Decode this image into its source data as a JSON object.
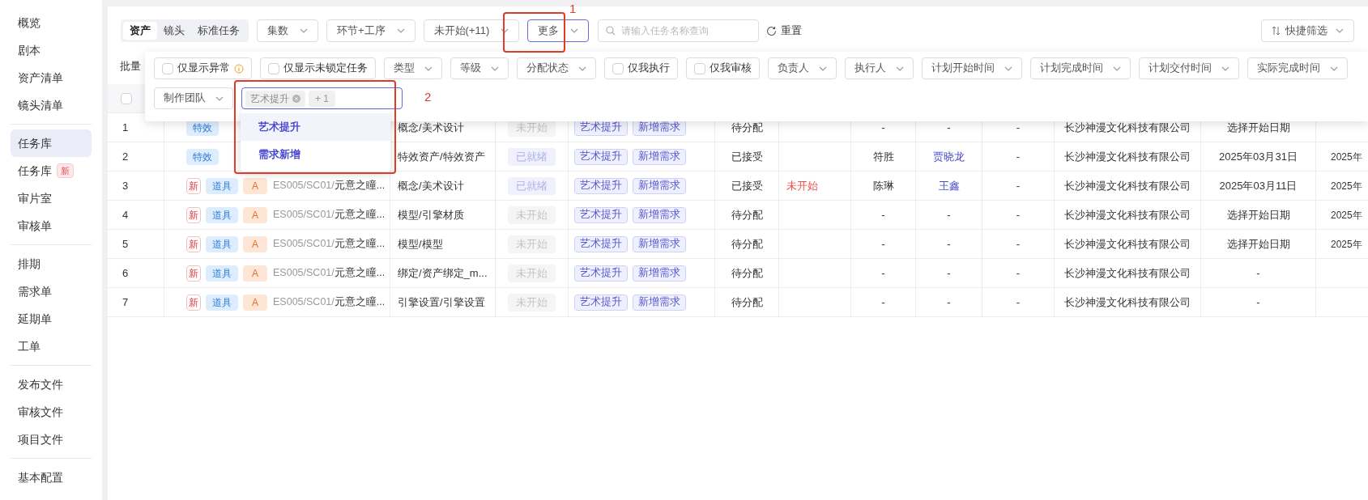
{
  "sidebar": {
    "groups": [
      {
        "items": [
          {
            "label": "概览",
            "selected": false
          },
          {
            "label": "剧本",
            "selected": false
          },
          {
            "label": "资产清单",
            "selected": false
          },
          {
            "label": "镜头清单",
            "selected": false
          }
        ]
      },
      {
        "items": [
          {
            "label": "任务库",
            "selected": true
          },
          {
            "label": "任务库",
            "selected": false,
            "badge": "新"
          },
          {
            "label": "审片室",
            "selected": false
          },
          {
            "label": "审核单",
            "selected": false
          }
        ]
      },
      {
        "items": [
          {
            "label": "排期",
            "selected": false
          },
          {
            "label": "需求单",
            "selected": false
          },
          {
            "label": "延期单",
            "selected": false
          },
          {
            "label": "工单",
            "selected": false
          }
        ]
      },
      {
        "items": [
          {
            "label": "发布文件",
            "selected": false
          },
          {
            "label": "审核文件",
            "selected": false
          },
          {
            "label": "项目文件",
            "selected": false
          }
        ]
      },
      {
        "items": [
          {
            "label": "基本配置",
            "selected": false
          }
        ]
      }
    ]
  },
  "toolbar": {
    "segments": [
      {
        "label": "资产",
        "selected": true
      },
      {
        "label": "镜头",
        "selected": false
      },
      {
        "label": "标准任务",
        "selected": false
      }
    ],
    "filters": [
      {
        "label": "集数",
        "active": false
      },
      {
        "label": "环节+工序",
        "active": false
      },
      {
        "label": "未开始(+11)",
        "active": false
      },
      {
        "label": "更多",
        "active": true
      }
    ],
    "search": {
      "placeholder": "请输入任务名称查询"
    },
    "reset": "重置",
    "quick_filter": "快捷筛选"
  },
  "batch_label": "批量",
  "header_checkbox": {
    "checked": false
  },
  "filter_panel": {
    "rows": [
      [
        {
          "kind": "checkbox",
          "label": "仅显示异常",
          "checked": false,
          "info": true
        },
        {
          "kind": "checkbox",
          "label": "仅显示未锁定任务",
          "checked": false
        },
        {
          "kind": "select",
          "label": "类型"
        },
        {
          "kind": "select",
          "label": "等级"
        },
        {
          "kind": "select",
          "label": "分配状态"
        },
        {
          "kind": "checkbox",
          "label": "仅我执行",
          "checked": false
        },
        {
          "kind": "checkbox",
          "label": "仅我审核",
          "checked": false
        },
        {
          "kind": "select",
          "label": "负责人"
        },
        {
          "kind": "select",
          "label": "执行人"
        },
        {
          "kind": "select",
          "label": "计划开始时间"
        },
        {
          "kind": "select",
          "label": "计划完成时间"
        },
        {
          "kind": "select",
          "label": "计划交付时间"
        },
        {
          "kind": "select",
          "label": "实际完成时间"
        }
      ],
      [
        {
          "kind": "select",
          "label": "制作团队"
        },
        {
          "kind": "multiselect",
          "tags": [
            "艺术提升"
          ],
          "more": "+ 1",
          "focused": true
        }
      ]
    ]
  },
  "option_list": [
    {
      "label": "艺术提升",
      "selected": true
    },
    {
      "label": "需求新增",
      "selected": false
    }
  ],
  "table": {
    "rows": [
      {
        "index": "1",
        "badges": [
          {
            "label": "特效",
            "kind": "type"
          }
        ],
        "step": "概念/美术设计",
        "status": {
          "label": "未开始",
          "kind": "not-started"
        },
        "tags": [
          "艺术提升",
          "新增需求"
        ],
        "assignment": "待分配",
        "owner": "-",
        "executor": {
          "label": "-",
          "link": false
        },
        "column_10": "-",
        "company": "长沙神漫文化科技有限公司",
        "date": "选择开始日期"
      },
      {
        "index": "2",
        "badges": [
          {
            "label": "特效",
            "kind": "type"
          }
        ],
        "step": "特效资产/特效资产",
        "status": {
          "label": "已就绪",
          "kind": "ready"
        },
        "tags": [
          "艺术提升",
          "新增需求"
        ],
        "assignment": "已接受",
        "owner": "符胜",
        "executor": {
          "label": "贾晓龙",
          "link": true
        },
        "column_10": "-",
        "company": "长沙神漫文化科技有限公司",
        "date": "2025年03月31日",
        "column_13": "2025年"
      },
      {
        "index": "3",
        "badges": [
          {
            "label": "新",
            "kind": "new"
          },
          {
            "label": "道具",
            "kind": "type"
          },
          {
            "label": "A",
            "kind": "grade"
          }
        ],
        "path": {
          "prefix": "ES005/SC01/",
          "name": "元意之瞳..."
        },
        "step": "概念/美术设计",
        "status": {
          "label": "已就绪",
          "kind": "ready"
        },
        "tags": [
          "艺术提升",
          "新增需求"
        ],
        "assignment": "已接受",
        "progress": "未开始",
        "owner": "陈琳",
        "executor": {
          "label": "王鑫",
          "link": true
        },
        "column_10": "-",
        "company": "长沙神漫文化科技有限公司",
        "date": "2025年03月11日",
        "column_13": "2025年"
      },
      {
        "index": "4",
        "badges": [
          {
            "label": "新",
            "kind": "new"
          },
          {
            "label": "道具",
            "kind": "type"
          },
          {
            "label": "A",
            "kind": "grade"
          }
        ],
        "path": {
          "prefix": "ES005/SC01/",
          "name": "元意之瞳..."
        },
        "step": "模型/引擎材质",
        "status": {
          "label": "未开始",
          "kind": "not-started"
        },
        "tags": [
          "艺术提升",
          "新增需求"
        ],
        "assignment": "待分配",
        "owner": "-",
        "executor": {
          "label": "-",
          "link": false
        },
        "column_10": "-",
        "company": "长沙神漫文化科技有限公司",
        "date": "选择开始日期",
        "column_13": "2025年"
      },
      {
        "index": "5",
        "badges": [
          {
            "label": "新",
            "kind": "new"
          },
          {
            "label": "道具",
            "kind": "type"
          },
          {
            "label": "A",
            "kind": "grade"
          }
        ],
        "path": {
          "prefix": "ES005/SC01/",
          "name": "元意之瞳..."
        },
        "step": "模型/模型",
        "status": {
          "label": "未开始",
          "kind": "not-started"
        },
        "tags": [
          "艺术提升",
          "新增需求"
        ],
        "assignment": "待分配",
        "owner": "-",
        "executor": {
          "label": "-",
          "link": false
        },
        "column_10": "-",
        "company": "长沙神漫文化科技有限公司",
        "date": "选择开始日期",
        "column_13": "2025年"
      },
      {
        "index": "6",
        "badges": [
          {
            "label": "新",
            "kind": "new"
          },
          {
            "label": "道具",
            "kind": "type"
          },
          {
            "label": "A",
            "kind": "grade"
          }
        ],
        "path": {
          "prefix": "ES005/SC01/",
          "name": "元意之瞳..."
        },
        "step": "绑定/资产绑定_m...",
        "status": {
          "label": "未开始",
          "kind": "not-started"
        },
        "tags": [
          "艺术提升",
          "新增需求"
        ],
        "assignment": "待分配",
        "owner": "-",
        "executor": {
          "label": "-",
          "link": false
        },
        "column_10": "-",
        "company": "长沙神漫文化科技有限公司",
        "date": "-"
      },
      {
        "index": "7",
        "badges": [
          {
            "label": "新",
            "kind": "new"
          },
          {
            "label": "道具",
            "kind": "type"
          },
          {
            "label": "A",
            "kind": "grade"
          }
        ],
        "path": {
          "prefix": "ES005/SC01/",
          "name": "元意之瞳..."
        },
        "step": "引擎设置/引擎设置",
        "status": {
          "label": "未开始",
          "kind": "not-started"
        },
        "tags": [
          "艺术提升",
          "新增需求"
        ],
        "assignment": "待分配",
        "owner": "-",
        "executor": {
          "label": "-",
          "link": false
        },
        "column_10": "-",
        "company": "长沙神漫文化科技有限公司",
        "date": "-"
      }
    ]
  },
  "annotations": [
    {
      "label": "1",
      "kind": "more-filter"
    },
    {
      "label": "2",
      "kind": "option-field"
    }
  ]
}
